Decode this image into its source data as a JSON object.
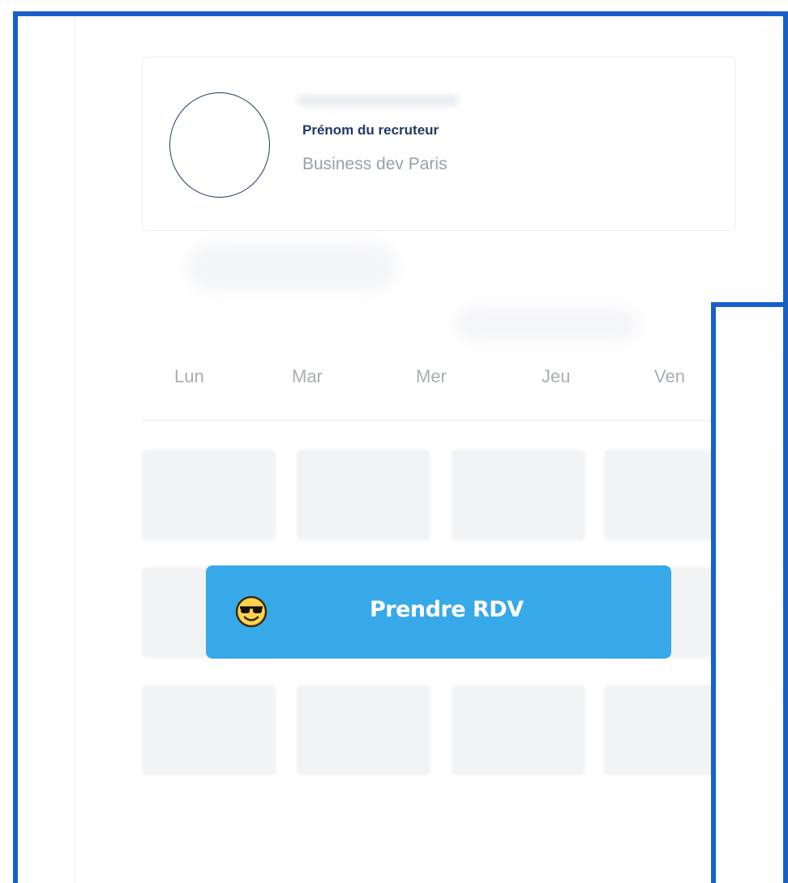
{
  "recruiter": {
    "name": "Prénom du recruteur",
    "role": "Business dev Paris"
  },
  "calendar": {
    "days": [
      "Lun",
      "Mar",
      "Mer",
      "Jeu",
      "Ven"
    ]
  },
  "cta": {
    "label": "Prendre RDV",
    "icon": "sunglasses-smiley-icon"
  },
  "colors": {
    "frame": "#1a5fc9",
    "button": "#38a9e8",
    "name_text": "#1f3a64",
    "role_text": "#98a0a8"
  }
}
